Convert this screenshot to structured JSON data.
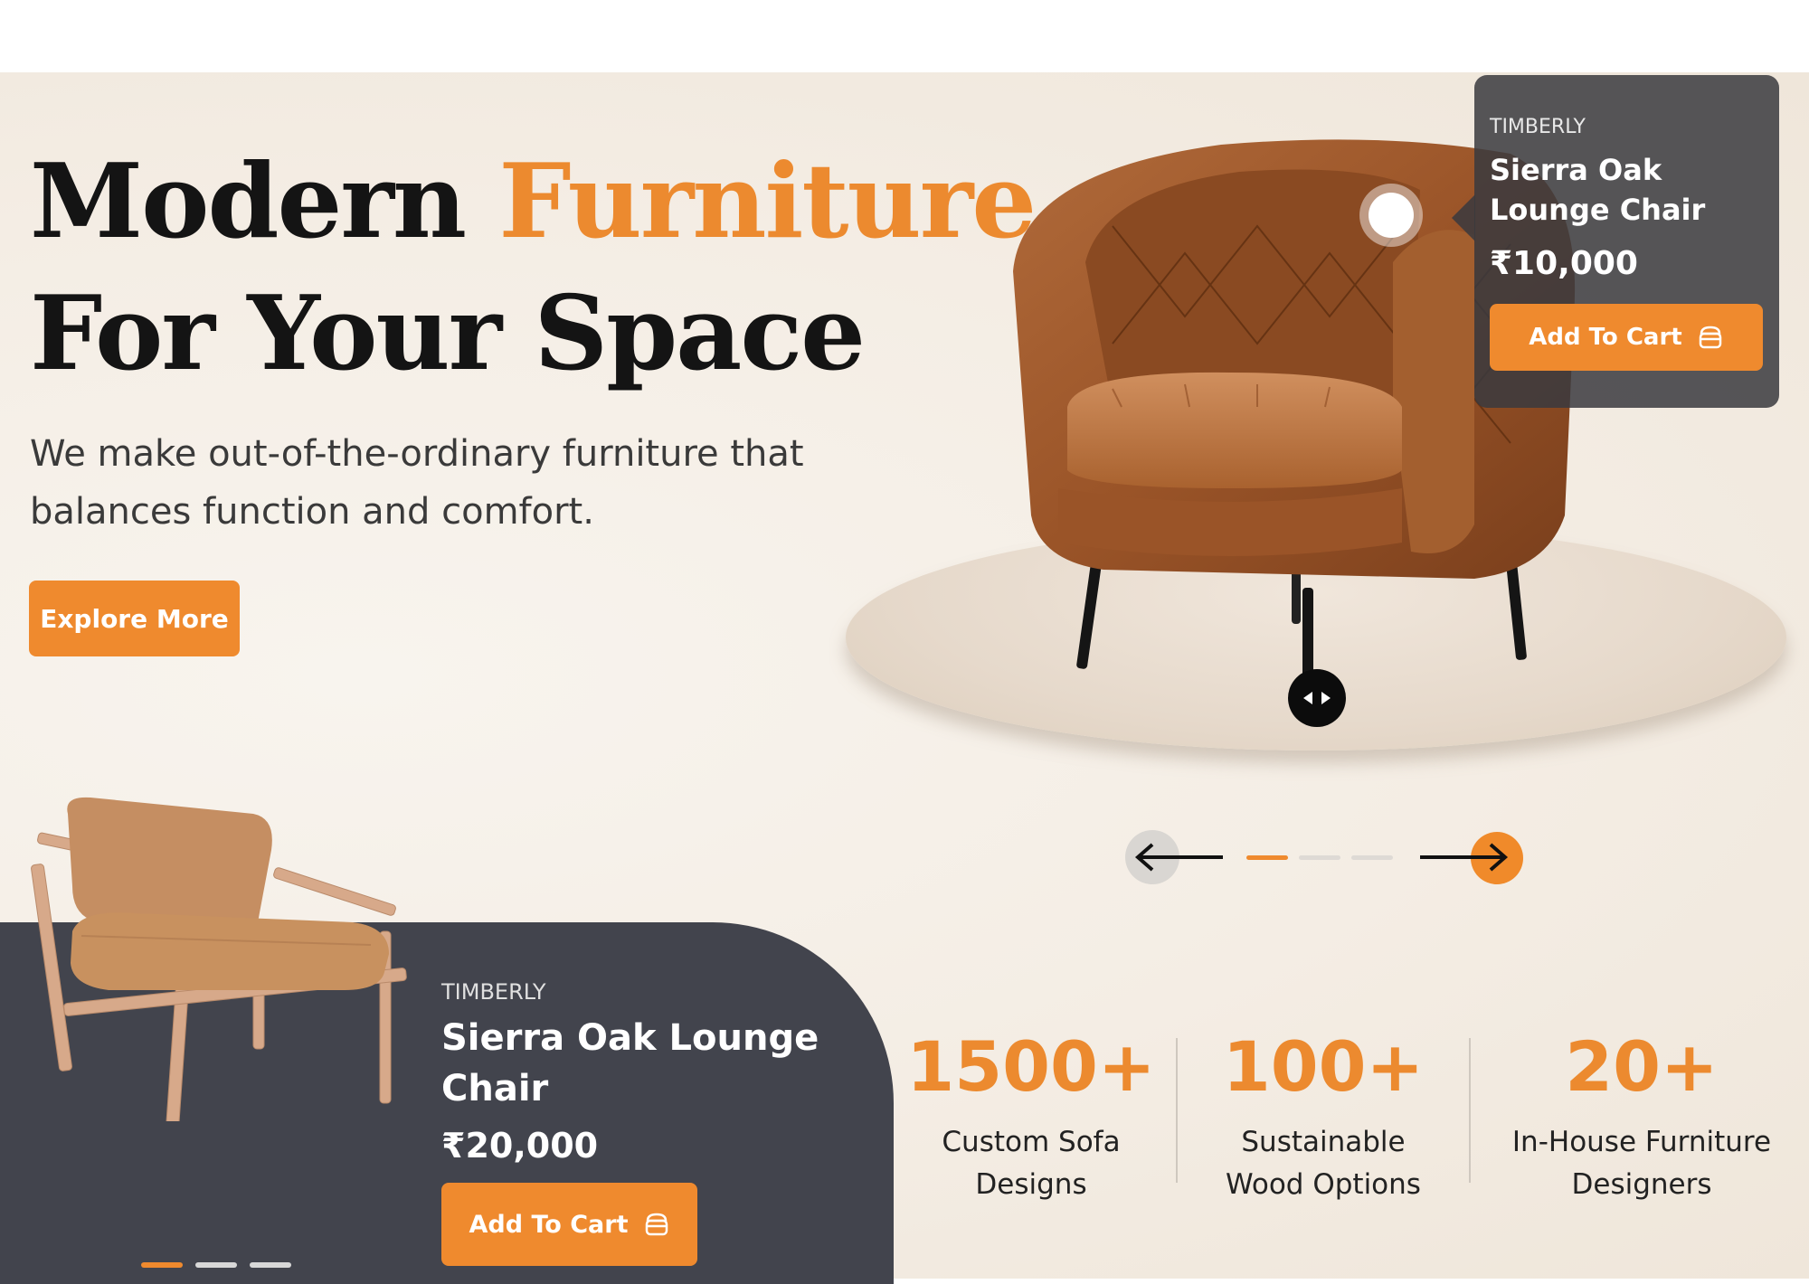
{
  "hero": {
    "headline_part1": "Modern ",
    "headline_accent": "Furniture",
    "headline_line2": "For Your Space",
    "subtext": "We make out-of-the-ordinary furniture that balances function and comfort.",
    "explore_label": "Explore More"
  },
  "featured_card": {
    "brand": "TIMBERLY",
    "name": "Sierra Oak Lounge Chair",
    "price": "₹10,000",
    "cart_label": "Add To Cart"
  },
  "bottom_card": {
    "brand": "TIMBERLY",
    "name": "Sierra Oak Lounge Chair",
    "price": "₹20,000",
    "cart_label": "Add To Cart"
  },
  "stats": [
    {
      "value": "1500+",
      "label": "Custom Sofa Designs"
    },
    {
      "value": "100+",
      "label": "Sustainable Wood Options"
    },
    {
      "value": "20+",
      "label": "In-House Furniture Designers"
    }
  ],
  "colors": {
    "accent": "#ef8a2e",
    "dark_panel": "#42444d",
    "text_dark": "#141414"
  },
  "icons": [
    "cart-icon",
    "arrow-left-icon",
    "arrow-right-icon",
    "swap-arrows-icon"
  ],
  "carousel": {
    "active_slide": 1,
    "total_slides": 3
  }
}
